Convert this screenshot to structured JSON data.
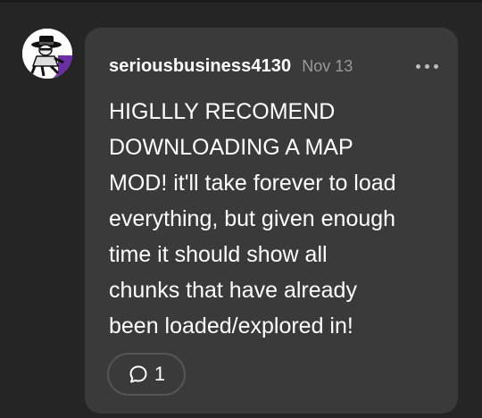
{
  "comment": {
    "username": "seriousbusiness4130",
    "timestamp": "Nov 13",
    "body": "HIGLLLY RECOMEND\nDOWNLOADING A MAP\nMOD! it'll take forever to load\neverything, but given enough\ntime it should show all\nchunks that have already\nbeen loaded/explored in!",
    "reply_count": "1",
    "avatar_icon": "spy-character-avatar",
    "more_icon": "more-horizontal-icon",
    "reply_icon": "speech-bubble-icon"
  },
  "colors": {
    "page_background": "#252525",
    "bubble_background": "#3a3a3a",
    "text_primary": "#ffffff",
    "text_secondary": "#9a9a9a",
    "avatar_accent": "#7b3fb5"
  }
}
